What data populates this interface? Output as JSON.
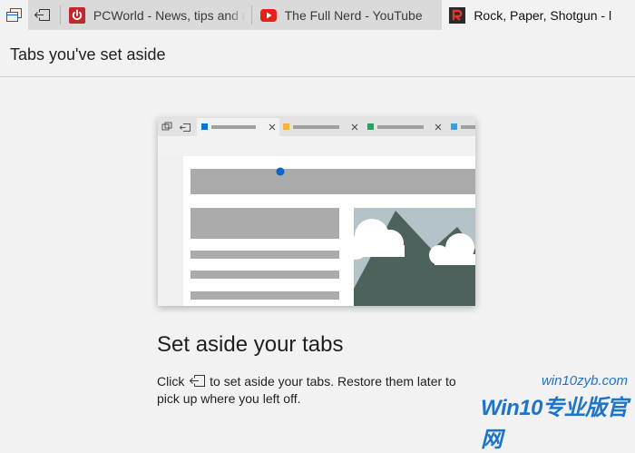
{
  "colors": {
    "accent": "#0067c0",
    "pcworld": "#c4262e",
    "youtube": "#e62117",
    "rps": "#2a2a2a"
  },
  "toolbar": {
    "tabs_aside_icon": "tabs-aside-icon",
    "set_aside_icon": "set-aside-tabs-icon"
  },
  "tabs": [
    {
      "label": "PCWorld - News, tips and re",
      "icon": "power-icon"
    },
    {
      "label": "The Full Nerd - YouTube",
      "icon": "youtube-play-icon"
    },
    {
      "label": "Rock, Paper, Shotgun - l",
      "icon": "rps-logo-icon"
    }
  ],
  "panel": {
    "title": "Tabs you've set aside",
    "heading": "Set aside your tabs",
    "desc_before": "Click ",
    "desc_after": " to set aside your tabs. Restore them later to pick up where you left off."
  },
  "watermark": {
    "url": "win10zyb.com",
    "main": "Win10专业版官网"
  }
}
